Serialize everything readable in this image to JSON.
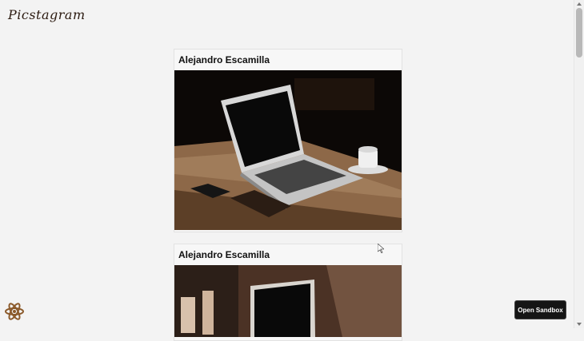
{
  "app": {
    "logo_text": "Picstagram"
  },
  "feed": {
    "posts": [
      {
        "author": "Alejandro Escamilla",
        "photo_description": "laptop-on-wooden-table"
      },
      {
        "author": "Alejandro Escamilla",
        "photo_description": "laptop-with-person"
      }
    ]
  },
  "footer": {
    "sandbox_label": "Open Sandbox"
  },
  "colors": {
    "background": "#f3f3f3",
    "button_bg": "#151515",
    "text": "#111111"
  }
}
